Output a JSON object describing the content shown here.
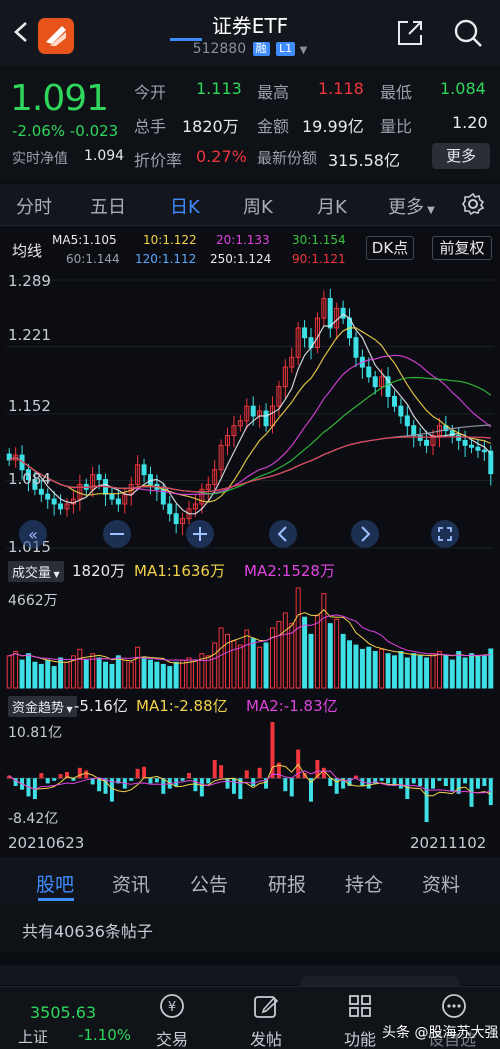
{
  "header": {
    "title": "证券ETF",
    "code": "512880",
    "badge_rong": "融",
    "badge_level": "L1"
  },
  "quote": {
    "price": "1.091",
    "change_pct": "-2.06%",
    "change": "-0.023",
    "nav_label": "实时净值",
    "nav_value": "1.094",
    "open_label": "今开",
    "open_value": "1.113",
    "high_label": "最高",
    "high_value": "1.118",
    "low_label": "最低",
    "low_value": "1.084",
    "volume_label": "总手",
    "volume_value": "1820万",
    "amount_label": "金额",
    "amount_value": "19.99亿",
    "ratio_label": "量比",
    "ratio_value": "1.20",
    "discount_label": "折价率",
    "discount_value": "0.27%",
    "shares_label": "最新份额",
    "shares_value": "315.58亿",
    "more_button": "更多"
  },
  "tabs": [
    "分时",
    "五日",
    "日K",
    "周K",
    "月K",
    "更多"
  ],
  "kline": {
    "label": "均线",
    "ma_row1": [
      {
        "text": "MA5:1.105",
        "color": "#e8eaee"
      },
      {
        "text": "10:1.122",
        "color": "#f2d24a"
      },
      {
        "text": "20:1.133",
        "color": "#e044e0"
      },
      {
        "text": "30:1.154",
        "color": "#35c43c"
      }
    ],
    "ma_row2": [
      {
        "text": "60:1.144",
        "color": "#9aa0aa"
      },
      {
        "text": "120:1.112",
        "color": "#5aa8ff"
      },
      {
        "text": "250:1.124",
        "color": "#e8eaee"
      },
      {
        "text": "90:1.121",
        "color": "#f0353d"
      }
    ],
    "dk_button": "DK点",
    "adjust_button": "前复权",
    "y_ticks": [
      "1.289",
      "1.221",
      "1.152",
      "1.084",
      "1.015"
    ]
  },
  "volume": {
    "tag": "成交量",
    "value": "1820万",
    "ma1": "MA1:1636万",
    "ma2": "MA2:1528万",
    "max_label": "4662万"
  },
  "fund_flow": {
    "tag": "资金趋势",
    "value": "-5.16亿",
    "ma1": "MA1:-2.88亿",
    "ma2": "MA2:-1.83亿",
    "max_label": "10.81亿",
    "min_label": "-8.42亿"
  },
  "date_start": "20210623",
  "date_end": "20211102",
  "bottom_tabs": [
    "股吧",
    "资讯",
    "公告",
    "研报",
    "持仓",
    "资料"
  ],
  "posts_count": "共有40636条帖子",
  "bottom_bar": {
    "index_value": "3505.63",
    "index_name": "上证",
    "index_change": "-1.10%",
    "items": [
      "交易",
      "发帖",
      "功能",
      "设自选"
    ]
  },
  "watermark": "头条 @股海苏大强",
  "colors": {
    "up": "#f0353d",
    "down": "#2fd65c",
    "accent": "#3f8cff",
    "cyan": "#3ee0e6"
  },
  "chart_data": [
    {
      "type": "candlestick",
      "title": "日K",
      "y_range": [
        1.015,
        1.289
      ],
      "y_ticks": [
        1.289,
        1.221,
        1.152,
        1.084,
        1.015
      ],
      "x_range": [
        "20210623",
        "20211102"
      ],
      "close_series": [
        1.105,
        1.11,
        1.095,
        1.085,
        1.075,
        1.07,
        1.065,
        1.06,
        1.055,
        1.06,
        1.065,
        1.08,
        1.075,
        1.09,
        1.085,
        1.07,
        1.065,
        1.06,
        1.07,
        1.08,
        1.1,
        1.09,
        1.08,
        1.075,
        1.06,
        1.05,
        1.04,
        1.045,
        1.055,
        1.06,
        1.075,
        1.08,
        1.095,
        1.12,
        1.13,
        1.14,
        1.145,
        1.16,
        1.15,
        1.155,
        1.14,
        1.16,
        1.18,
        1.2,
        1.21,
        1.24,
        1.23,
        1.22,
        1.25,
        1.27,
        1.24,
        1.26,
        1.25,
        1.23,
        1.21,
        1.2,
        1.19,
        1.18,
        1.19,
        1.17,
        1.16,
        1.15,
        1.14,
        1.13,
        1.125,
        1.12,
        1.13,
        1.14,
        1.135,
        1.13,
        1.125,
        1.12,
        1.118,
        1.115,
        1.114,
        1.091
      ],
      "series_lines": [
        {
          "name": "MA5",
          "color": "#e8eaee"
        },
        {
          "name": "10",
          "color": "#f2d24a"
        },
        {
          "name": "20",
          "color": "#e044e0"
        },
        {
          "name": "30",
          "color": "#35c43c"
        },
        {
          "name": "60",
          "color": "#9aa0aa"
        },
        {
          "name": "120",
          "color": "#5aa8ff"
        },
        {
          "name": "90",
          "color": "#f0353d"
        }
      ]
    },
    {
      "type": "bar",
      "title": "成交量",
      "max": 4662,
      "unit": "万",
      "values": [
        1500,
        1700,
        1300,
        1600,
        1200,
        1100,
        1300,
        1000,
        1400,
        1200,
        1500,
        1800,
        1300,
        1600,
        1400,
        1200,
        1100,
        1500,
        1300,
        1200,
        1900,
        1400,
        1300,
        1200,
        1100,
        1000,
        1200,
        1300,
        1400,
        1300,
        1600,
        1500,
        2100,
        2800,
        2500,
        2200,
        2000,
        2700,
        2300,
        1900,
        2100,
        2800,
        3100,
        3500,
        3000,
        4662,
        3300,
        2500,
        3400,
        4400,
        3000,
        3200,
        2500,
        2200,
        2000,
        1800,
        1900,
        1700,
        1800,
        1600,
        1500,
        1700,
        1400,
        1600,
        1500,
        1400,
        1600,
        1700,
        1500,
        1300,
        1700,
        1400,
        1600,
        1500,
        1500,
        1820
      ]
    },
    {
      "type": "bar",
      "title": "资金趋势",
      "range": [
        -8.42,
        10.81
      ],
      "unit": "亿",
      "values": [
        0.5,
        -1.5,
        -2.2,
        -3.5,
        -4.0,
        1.0,
        -1.0,
        -0.5,
        0.8,
        1.2,
        -0.5,
        2.0,
        1.5,
        -1.2,
        -2.5,
        -3.0,
        -4.5,
        -1.0,
        -2.0,
        -0.5,
        1.8,
        2.2,
        -1.0,
        -0.8,
        -3.0,
        -2.0,
        -1.5,
        -0.5,
        1.0,
        -2.5,
        -3.5,
        -1.0,
        3.5,
        2.5,
        -2.0,
        -3.0,
        -4.0,
        1.5,
        -1.5,
        2.0,
        -2.0,
        10.81,
        3.0,
        -2.5,
        -3.5,
        5.5,
        1.0,
        -4.5,
        3.5,
        2.0,
        -1.5,
        -3.0,
        -2.0,
        -1.5,
        0.5,
        -1.5,
        -2.0,
        -1.0,
        -0.5,
        -1.0,
        -1.5,
        -2.0,
        -4.0,
        -1.0,
        -1.5,
        -8.42,
        -2.0,
        -0.5,
        -1.5,
        -2.5,
        -3.0,
        -1.0,
        -5.5,
        -2.0,
        -1.5,
        -5.16
      ]
    }
  ]
}
